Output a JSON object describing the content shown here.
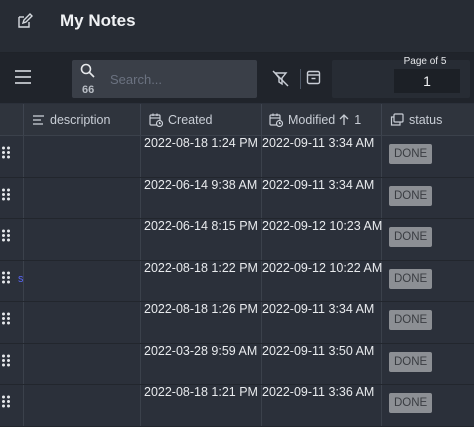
{
  "app": {
    "title": "My Notes"
  },
  "toolbar": {
    "search_placeholder": "Search...",
    "search_count": "66",
    "pager_label": "Page of 5",
    "page_value": "1"
  },
  "table": {
    "columns": {
      "description": "description",
      "created": "Created",
      "modified": "Modified",
      "sort_rank": "1",
      "status": "status"
    },
    "rows": [
      {
        "created": "2022-08-18 1:24 PM",
        "modified": "2022-09-11 3:34 AM",
        "status": "DONE",
        "desc": ""
      },
      {
        "created": "2022-06-14 9:38 AM",
        "modified": "2022-09-11 3:34 AM",
        "status": "DONE",
        "desc": ""
      },
      {
        "created": "2022-06-14 8:15 PM",
        "modified": "2022-09-12 10:23 AM",
        "status": "DONE",
        "desc": ""
      },
      {
        "created": "2022-08-18 1:22 PM",
        "modified": "2022-09-12 10:22 AM",
        "status": "DONE",
        "desc": "s"
      },
      {
        "created": "2022-08-18 1:26 PM",
        "modified": "2022-09-11 3:34 AM",
        "status": "DONE",
        "desc": ""
      },
      {
        "created": "2022-03-28 9:59 AM",
        "modified": "2022-09-11 3:50 AM",
        "status": "DONE",
        "desc": ""
      },
      {
        "created": "2022-08-18 1:21 PM",
        "modified": "2022-09-11 3:36 AM",
        "status": "DONE",
        "desc": ""
      }
    ]
  },
  "colors": {
    "background": "#2b303a",
    "header": "#272c34",
    "toolbar": "#20242b",
    "status_badge": "#8c8f94"
  }
}
